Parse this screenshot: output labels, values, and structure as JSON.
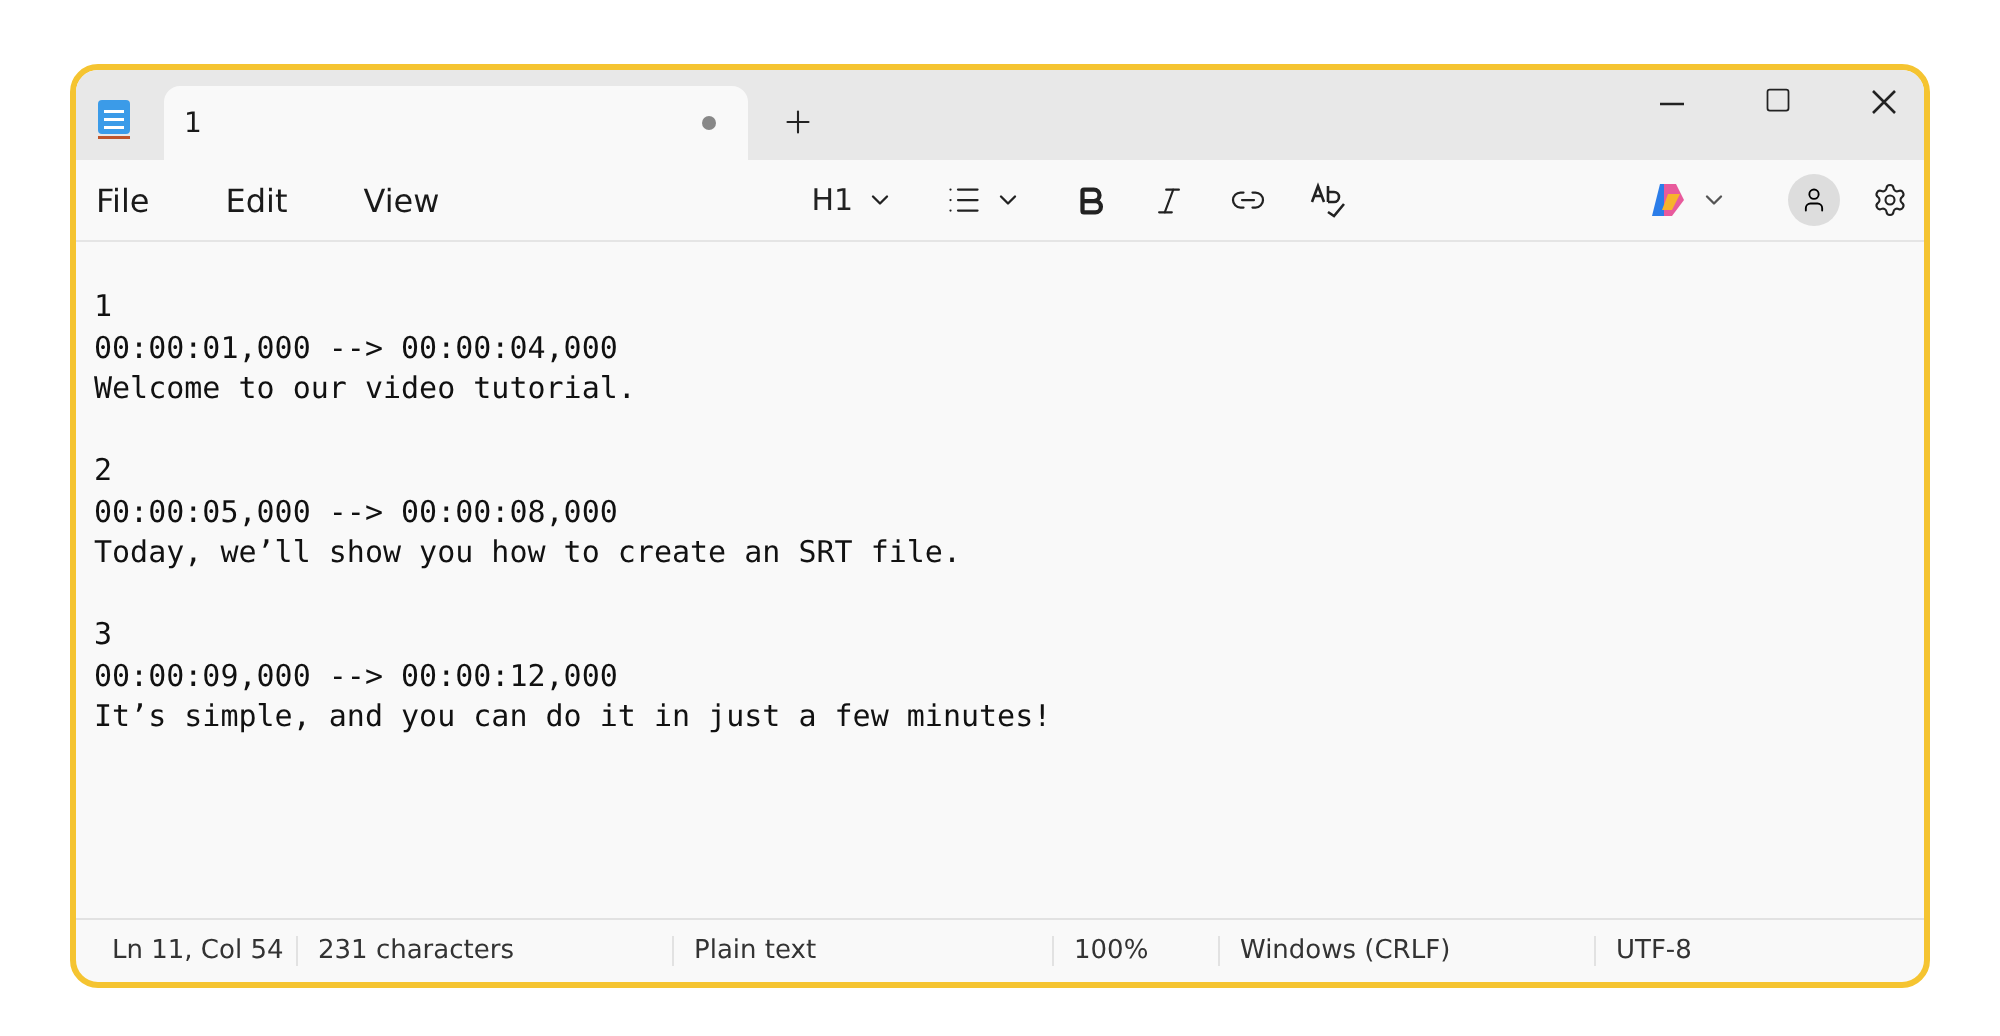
{
  "tabs": [
    {
      "label": "1",
      "selected": true,
      "unsaved": true
    }
  ],
  "menu": [
    "File",
    "Edit",
    "View"
  ],
  "toolbar": {
    "heading": "H1"
  },
  "editor": {
    "blocks": [
      {
        "index": "1",
        "timing": "00:00:01,000 --> 00:00:04,000",
        "text": "Welcome to our video tutorial."
      },
      {
        "index": "2",
        "timing": "00:00:05,000 --> 00:00:08,000",
        "text": "Today, we’ll show you how to create an SRT file."
      },
      {
        "index": "3",
        "timing": "00:00:09,000 --> 00:00:12,000",
        "text": "It’s simple, and you can do it in just a few minutes!"
      }
    ]
  },
  "status_bar": [
    "Ln 11, Col 54",
    "231 characters",
    "Plain text",
    "100%",
    "Windows (CRLF)",
    "UTF-8"
  ]
}
